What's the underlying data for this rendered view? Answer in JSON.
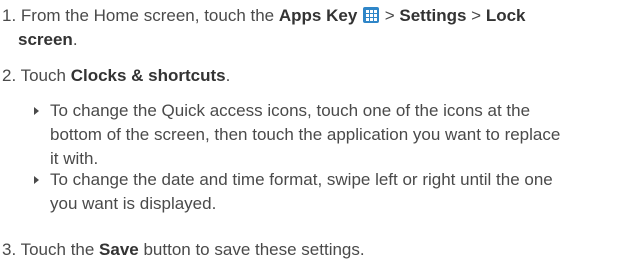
{
  "steps": [
    {
      "number": "1.",
      "segments": [
        {
          "text": " From the Home screen, touch the ",
          "bold": false
        },
        {
          "text": "Apps Key",
          "bold": true
        },
        {
          "text": " > ",
          "bold": false
        },
        {
          "text": "Settings",
          "bold": true
        },
        {
          "text": " > ",
          "bold": false
        },
        {
          "text": "Lock",
          "bold": true
        }
      ],
      "continuation": [
        {
          "text": "screen",
          "bold": true
        },
        {
          "text": ".",
          "bold": false
        }
      ]
    },
    {
      "number": "2.",
      "segments": [
        {
          "text": " Touch ",
          "bold": false
        },
        {
          "text": "Clocks & shortcuts",
          "bold": true
        },
        {
          "text": ".",
          "bold": false
        }
      ],
      "bullets": [
        {
          "lines": [
            "To change the Quick access icons, touch one of the icons at the",
            "bottom of the screen, then touch the application you want to replace",
            "it with."
          ]
        },
        {
          "lines": [
            "To change the date and time format, swipe left or right until the one",
            "you want is displayed."
          ]
        }
      ]
    },
    {
      "number": "3.",
      "segments": [
        {
          "text": " Touch the ",
          "bold": false
        },
        {
          "text": "Save",
          "bold": true
        },
        {
          "text": " button to save these settings.",
          "bold": false
        }
      ]
    }
  ],
  "icons": {
    "apps_key": "apps-grid-icon",
    "bullet": "triangle-bullet-icon"
  },
  "colors": {
    "text": "#4a4a4a",
    "bold_text": "#333333",
    "apps_icon": "#2f86c8"
  }
}
